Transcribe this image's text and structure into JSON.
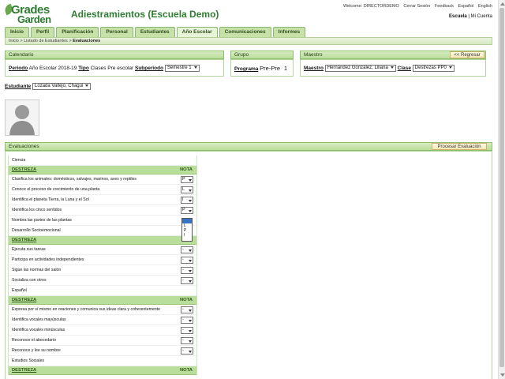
{
  "logo": {
    "line1": "Grades",
    "line2": "Garden"
  },
  "app_title": "Adiestramientos (Escuela Demo)",
  "top_links": [
    "Welcome: DIRECTORDEMO",
    "Cerrar Sesión",
    "Feedback",
    "Español",
    "English"
  ],
  "school_links": {
    "escuela": "Escuela",
    "sep": " | ",
    "cuenta": "Mi Cuenta"
  },
  "nav_tabs": [
    "Inicio",
    "Perfil",
    "Planificación",
    "Personal",
    "Estudiantes",
    "Año Escolar",
    "Comunicaciones",
    "Informes"
  ],
  "active_tab": "Año Escolar",
  "breadcrumb": [
    "Inicio",
    "Listado de Estudiantes",
    "Evaluaciones"
  ],
  "calendario": {
    "title": "Calendario",
    "periodo_label": "Periodo",
    "periodo_value": "Año Escolar 2018-19",
    "tipo_label": "Tipo",
    "tipo_value": "Clases Pre escolar",
    "subperiodo_label": "Subperiodo",
    "subperiodo_value": "Semestre 1"
  },
  "grupo": {
    "title": "Grupo",
    "programa_label": "Programa",
    "programa_value": "Pre-Pre",
    "num": "1"
  },
  "maestro": {
    "title": "Maestro",
    "regresar": "<< Regresar",
    "maestro_label": "Maestro",
    "maestro_value": "Hernández González, Liliana",
    "clase_label": "Clase",
    "clase_value": "Destrezas PP0"
  },
  "estudiante": {
    "label": "Estudiante",
    "value": "Lozada Vallejo, Chagui"
  },
  "evaluaciones": {
    "title": "Evaluaciones",
    "procesar": "Procesar Evaluación",
    "col_destreza": "DESTREZA",
    "col_nota": "NOTA",
    "sections": [
      {
        "subject": "Ciencia",
        "items": [
          {
            "label": "Clasifica los animales: domésticos, salvajes, marinos, aves y reptiles",
            "nota": "P"
          },
          {
            "label": "Conoce el proceso de crecimiento de una planta",
            "nota": "L"
          },
          {
            "label": "Identifica el planeta Tierra, la Luna y el Sol",
            "nota": "I"
          },
          {
            "label": "Identifica los cinco sentidos",
            "nota": "P"
          },
          {
            "label": "Nombra las partes de las plantas",
            "nota": ""
          }
        ]
      },
      {
        "subject": "Desarrollo Socioemocional",
        "items": [
          {
            "label": "Ejecuta sus tareas",
            "nota": "-"
          },
          {
            "label": "Participa en actividades independientes",
            "nota": "-"
          },
          {
            "label": "Sigue las normas del salón",
            "nota": "-"
          },
          {
            "label": "Socializa con otros",
            "nota": "-"
          }
        ]
      },
      {
        "subject": "Español",
        "items": [
          {
            "label": "Expresa por sí mismo en oraciones y comunica sus ideas clara y coherentemente",
            "nota": "-"
          },
          {
            "label": "Identifica vocales mayúsculas",
            "nota": "-"
          },
          {
            "label": "Identifica vocales minúsculas",
            "nota": "-"
          },
          {
            "label": "Reconoce el abecedario",
            "nota": "-"
          },
          {
            "label": "Reconoce y lee su nombre",
            "nota": "-"
          }
        ]
      },
      {
        "subject": "Estudios Sociales",
        "items": []
      }
    ],
    "open_dropdown_options": [
      "",
      "L",
      "P",
      "I"
    ]
  }
}
